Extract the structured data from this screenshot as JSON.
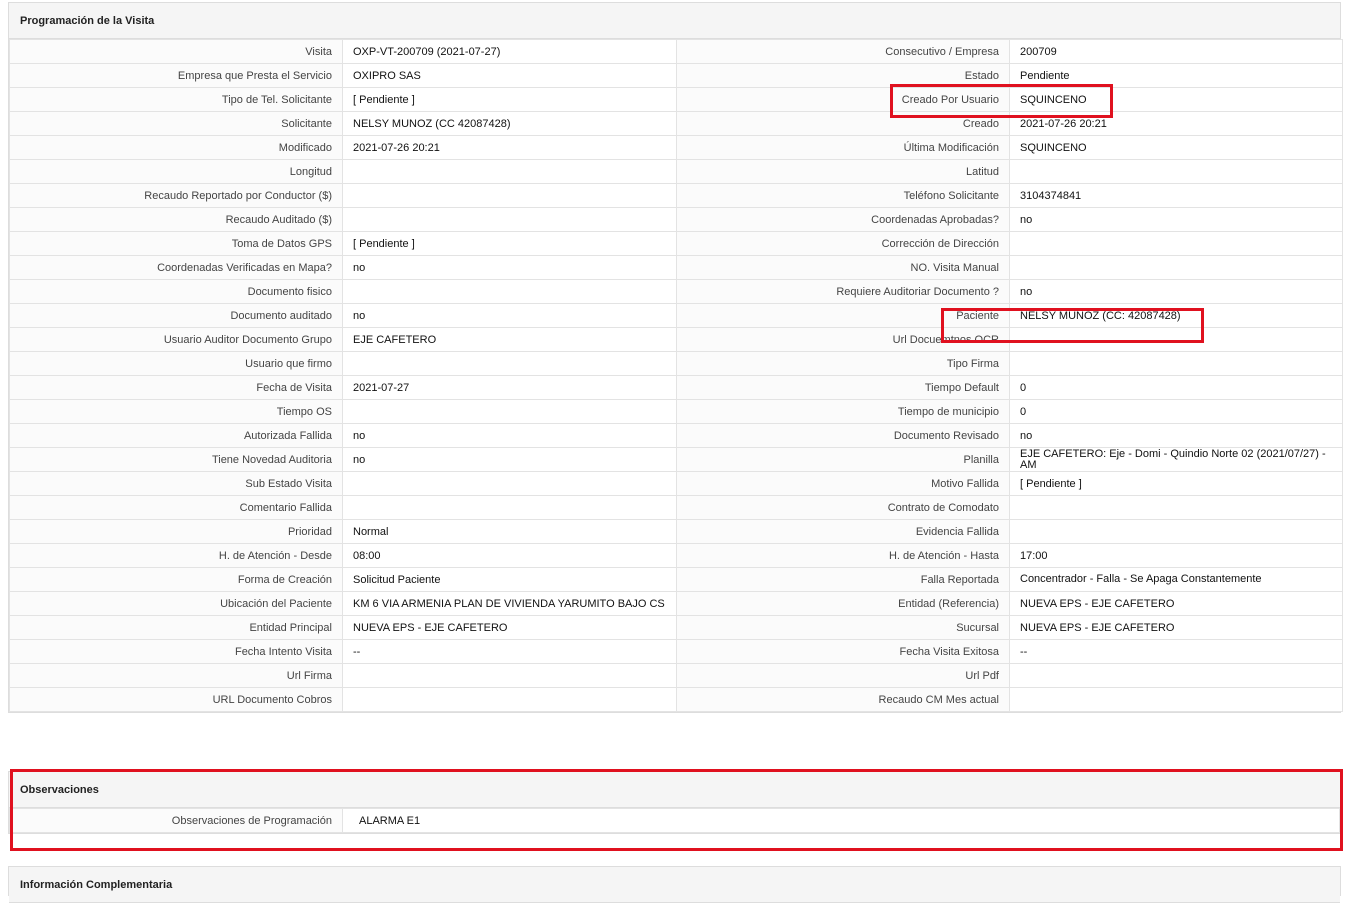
{
  "programacion": {
    "title": "Programación de la Visita",
    "rows": [
      {
        "l1": "Visita",
        "v1": "OXP-VT-200709 (2021-07-27)",
        "l2": "Consecutivo / Empresa",
        "v2": "200709"
      },
      {
        "l1": "Empresa que Presta el Servicio",
        "v1": "OXIPRO SAS",
        "l2": "Estado",
        "v2": "Pendiente"
      },
      {
        "l1": "Tipo de Tel. Solicitante",
        "v1": "[ Pendiente ]",
        "l2": "Creado Por Usuario",
        "v2": "SQUINCENO"
      },
      {
        "l1": "Solicitante",
        "v1": "NELSY MUNOZ (CC 42087428)",
        "l2": "Creado",
        "v2": "2021-07-26 20:21"
      },
      {
        "l1": "Modificado",
        "v1": "2021-07-26 20:21",
        "l2": "Última Modificación",
        "v2": " SQUINCENO"
      },
      {
        "l1": "Longitud",
        "v1": "",
        "l2": "Latitud",
        "v2": ""
      },
      {
        "l1": "Recaudo Reportado por Conductor ($)",
        "v1": "",
        "l2": "Teléfono Solicitante",
        "v2": "3104374841"
      },
      {
        "l1": "Recaudo Auditado ($)",
        "v1": "",
        "l2": "Coordenadas Aprobadas?",
        "v2": " no"
      },
      {
        "l1": "Toma de Datos GPS",
        "v1": "[ Pendiente ]",
        "l2": "Corrección de Dirección",
        "v2": ""
      },
      {
        "l1": "Coordenadas Verificadas en Mapa?",
        "v1": " no",
        "l2": "NO. Visita Manual",
        "v2": ""
      },
      {
        "l1": "Documento fisico",
        "v1": "",
        "l2": "Requiere Auditoriar Documento ?",
        "v2": " no"
      },
      {
        "l1": "Documento auditado",
        "v1": " no",
        "l2": "Paciente",
        "v2": "NELSY MUNOZ (CC: 42087428)"
      },
      {
        "l1": "Usuario Auditor Documento Grupo",
        "v1": "EJE CAFETERO",
        "l2": "Url Docuemtnos OCR",
        "v2": ""
      },
      {
        "l1": "Usuario que firmo",
        "v1": "",
        "l2": "Tipo Firma",
        "v2": ""
      },
      {
        "l1": "Fecha de Visita",
        "v1": " 2021-07-27",
        "l2": "Tiempo Default",
        "v2": "0"
      },
      {
        "l1": "Tiempo OS",
        "v1": "",
        "l2": "Tiempo de municipio",
        "v2": "0"
      },
      {
        "l1": "Autorizada Fallida",
        "v1": " no",
        "l2": "Documento Revisado",
        "v2": " no"
      },
      {
        "l1": "Tiene Novedad Auditoria",
        "v1": " no",
        "l2": "Planilla",
        "v2": "EJE CAFETERO: Eje - Domi - Quindio Norte 02 (2021/07/27) - AM"
      },
      {
        "l1": "Sub Estado Visita",
        "v1": "",
        "l2": "Motivo Fallida",
        "v2": "[ Pendiente ]"
      },
      {
        "l1": "Comentario Fallida",
        "v1": "",
        "l2": "Contrato de Comodato",
        "v2": ""
      },
      {
        "l1": "Prioridad",
        "v1": "Normal",
        "l2": "Evidencia Fallida",
        "v2": ""
      },
      {
        "l1": "H. de Atención - Desde",
        "v1": "08:00",
        "l2": "H. de Atención - Hasta",
        "v2": "17:00"
      },
      {
        "l1": "Forma de Creación",
        "v1": "Solicitud Paciente",
        "l2": "Falla Reportada",
        "v2": "Concentrador - Falla - Se Apaga Constantemente"
      },
      {
        "l1": "Ubicación del Paciente",
        "v1": "KM 6 VIA ARMENIA PLAN DE VIVIENDA YARUMITO BAJO CS",
        "l2": "Entidad (Referencia)",
        "v2": "NUEVA EPS - EJE CAFETERO"
      },
      {
        "l1": "Entidad Principal",
        "v1": "NUEVA EPS - EJE CAFETERO",
        "l2": "Sucursal",
        "v2": "NUEVA EPS - EJE CAFETERO"
      },
      {
        "l1": "Fecha Intento Visita",
        "v1": " --",
        "l2": "Fecha Visita Exitosa",
        "v2": " --"
      },
      {
        "l1": "Url Firma",
        "v1": "",
        "l2": "Url Pdf",
        "v2": ""
      },
      {
        "l1": "URL Documento Cobros",
        "v1": "",
        "l2": "Recaudo CM Mes actual",
        "v2": ""
      }
    ]
  },
  "observaciones": {
    "title": "Observaciones",
    "label": "Observaciones de Programación",
    "value": "ALARMA E1"
  },
  "complementaria": {
    "title": "Información Complementaria"
  },
  "colors": {
    "highlight": "#e0111f",
    "header_bg": "#f5f5f5",
    "border": "#e3e3e3"
  }
}
